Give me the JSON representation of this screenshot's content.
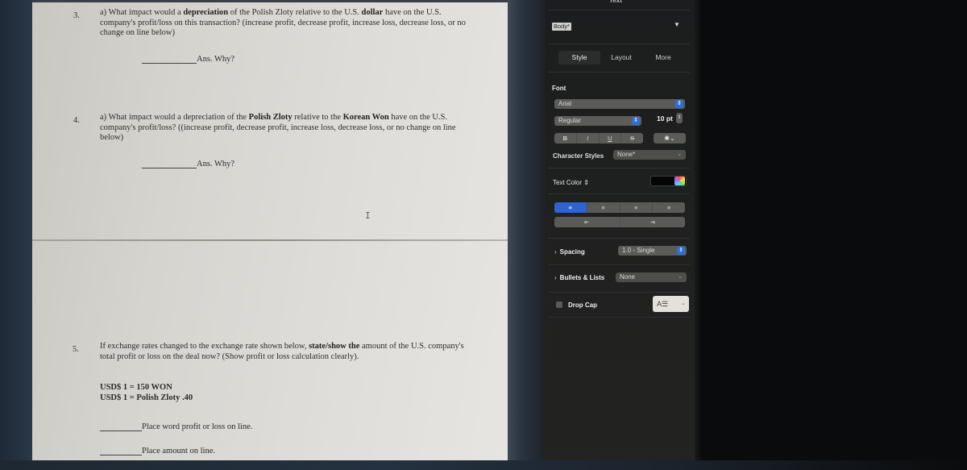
{
  "document": {
    "questions": [
      {
        "number": "3.",
        "text_parts": [
          {
            "t": "a) What impact would a ",
            "b": false
          },
          {
            "t": "depreciation",
            "b": true
          },
          {
            "t": " of the Polish Zloty relative to the U.S. ",
            "b": false
          },
          {
            "t": "dollar",
            "b": true
          },
          {
            "t": " have on the U.S. company's profit/loss on this transaction? (increase profit, decrease profit, increase loss, decrease loss, or no change on line below)",
            "b": false
          }
        ],
        "answer_label": "Ans. Why?"
      },
      {
        "number": "4.",
        "text_parts": [
          {
            "t": "a) What impact would a depreciation of the ",
            "b": false
          },
          {
            "t": "Polish Zloty",
            "b": true
          },
          {
            "t": " relative to the ",
            "b": false
          },
          {
            "t": "Korean Won",
            "b": true
          },
          {
            "t": " have on the U.S. company's profit/loss?  ((increase profit, decrease profit, increase loss, decrease loss, or no change on line below)",
            "b": false
          }
        ],
        "answer_label": "Ans.  Why?"
      },
      {
        "number": "5.",
        "text_parts": [
          {
            "t": "If exchange rates changed to the exchange rate shown below, ",
            "b": false
          },
          {
            "t": "state/show the",
            "b": true
          },
          {
            "t": " amount of the U.S. company's total profit or loss on the deal now?  (Show profit or loss calculation clearly).",
            "b": false
          }
        ],
        "rates": [
          "USD$ 1 = 150 WON",
          "USD$ 1 = Polish Zloty .40"
        ],
        "answer_lines": [
          "Place word profit or loss on line.",
          "Place amount on line."
        ]
      }
    ],
    "cursor_glyph": "I"
  },
  "inspector": {
    "title_cut": "Text",
    "paragraph_style": "Body*",
    "tabs": [
      {
        "label": "Style",
        "active": true
      },
      {
        "label": "Layout",
        "active": false
      },
      {
        "label": "More",
        "active": false
      }
    ],
    "font": {
      "section_label": "Font",
      "family": "Arial",
      "typeface": "Regular",
      "size": "10 pt",
      "style_buttons": [
        "B",
        "I",
        "U",
        "S"
      ],
      "options_icon": "gear-icon"
    },
    "character_styles": {
      "label": "Character Styles",
      "value": "None*"
    },
    "text_color": {
      "label": "Text Color ⇕",
      "value": "#000000"
    },
    "alignment": {
      "buttons": [
        "align-left",
        "align-center",
        "align-right",
        "justify"
      ],
      "selected": "align-left",
      "indent_buttons": [
        "decrease-indent",
        "increase-indent"
      ]
    },
    "spacing": {
      "label": "Spacing",
      "value": "1.0 - Single"
    },
    "bullets": {
      "label": "Bullets & Lists",
      "value": "None"
    },
    "drop_cap": {
      "label": "Drop Cap",
      "checked": false
    },
    "accent_color": "#2f63d0"
  }
}
